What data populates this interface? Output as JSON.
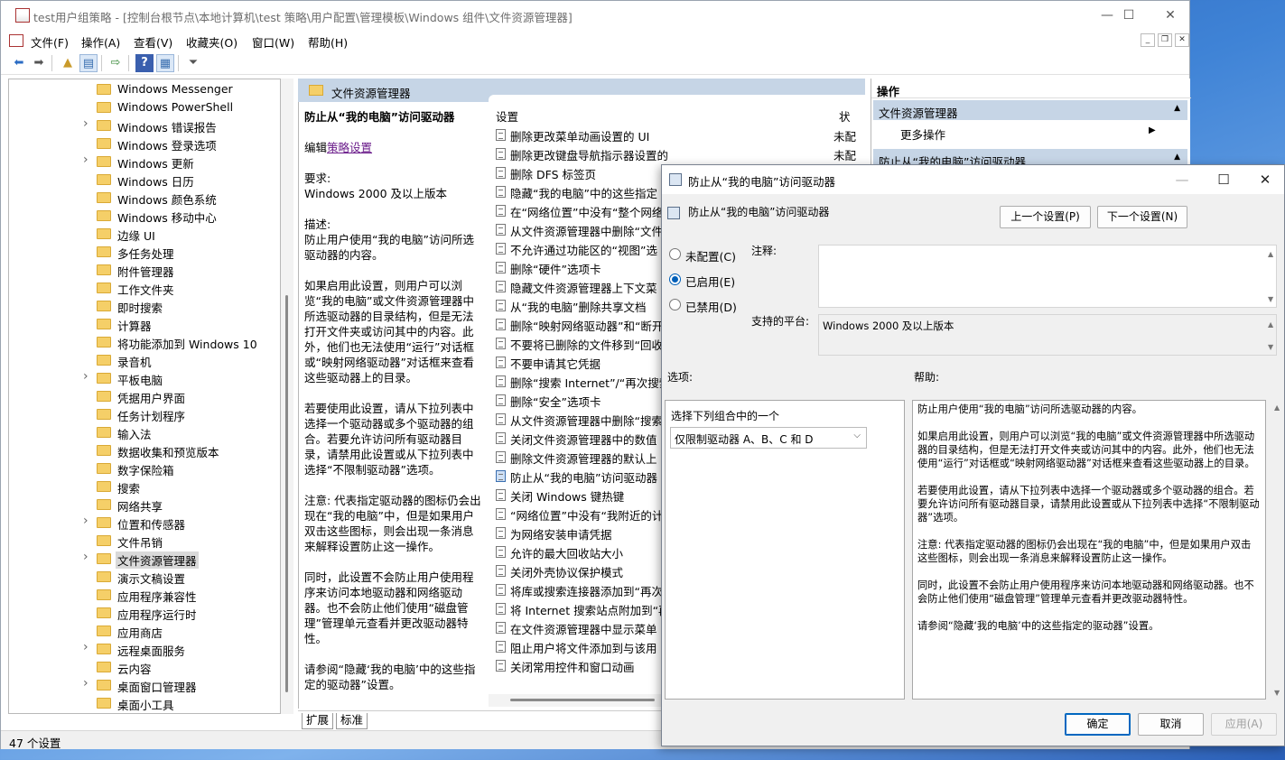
{
  "window": {
    "title": "test用户组策略 - [控制台根节点\\本地计算机\\test 策略\\用户配置\\管理模板\\Windows 组件\\文件资源管理器]",
    "minimize": "—",
    "maximize": "☐",
    "close": "✕"
  },
  "menu": [
    "文件(F)",
    "操作(A)",
    "查看(V)",
    "收藏夹(O)",
    "窗口(W)",
    "帮助(H)"
  ],
  "mdi_controls": [
    "_",
    "❐",
    "✕"
  ],
  "toolbar_icons": [
    "back-arrow-icon",
    "forward-arrow-icon",
    "up-folder-icon",
    "show-tree-icon",
    "export-list-icon",
    "help-icon",
    "show-hide-action-pane-icon",
    "filter-icon"
  ],
  "tree": {
    "items": [
      {
        "label": "Windows Messenger",
        "expandable": false
      },
      {
        "label": "Windows PowerShell",
        "expandable": false
      },
      {
        "label": "Windows 错误报告",
        "expandable": true
      },
      {
        "label": "Windows 登录选项",
        "expandable": false
      },
      {
        "label": "Windows 更新",
        "expandable": true
      },
      {
        "label": "Windows 日历",
        "expandable": false
      },
      {
        "label": "Windows 颜色系统",
        "expandable": false
      },
      {
        "label": "Windows 移动中心",
        "expandable": false
      },
      {
        "label": "边缘 UI",
        "expandable": false
      },
      {
        "label": "多任务处理",
        "expandable": false
      },
      {
        "label": "附件管理器",
        "expandable": false
      },
      {
        "label": "工作文件夹",
        "expandable": false
      },
      {
        "label": "即时搜索",
        "expandable": false
      },
      {
        "label": "计算器",
        "expandable": false
      },
      {
        "label": "将功能添加到 Windows 10",
        "expandable": false
      },
      {
        "label": "录音机",
        "expandable": false
      },
      {
        "label": "平板电脑",
        "expandable": true
      },
      {
        "label": "凭据用户界面",
        "expandable": false
      },
      {
        "label": "任务计划程序",
        "expandable": false
      },
      {
        "label": "输入法",
        "expandable": false
      },
      {
        "label": "数据收集和预览版本",
        "expandable": false
      },
      {
        "label": "数字保险箱",
        "expandable": false
      },
      {
        "label": "搜索",
        "expandable": false
      },
      {
        "label": "网络共享",
        "expandable": false
      },
      {
        "label": "位置和传感器",
        "expandable": true
      },
      {
        "label": "文件吊销",
        "expandable": false
      },
      {
        "label": "文件资源管理器",
        "expandable": true,
        "selected": true
      },
      {
        "label": "演示文稿设置",
        "expandable": false
      },
      {
        "label": "应用程序兼容性",
        "expandable": false
      },
      {
        "label": "应用程序运行时",
        "expandable": false
      },
      {
        "label": "应用商店",
        "expandable": false
      },
      {
        "label": "远程桌面服务",
        "expandable": true
      },
      {
        "label": "云内容",
        "expandable": false
      },
      {
        "label": "桌面窗口管理器",
        "expandable": true
      },
      {
        "label": "桌面小工具",
        "expandable": false
      }
    ]
  },
  "middle": {
    "header": "文件资源管理器",
    "desc": {
      "title": "防止从“我的电脑”访问驱动器",
      "edit_prefix": "编辑",
      "edit_link": "策略设置",
      "req_label": "要求:",
      "req_value": "Windows 2000 及以上版本",
      "desc_label": "描述:",
      "desc_1": "防止用户使用“我的电脑”访问所选驱动器的内容。",
      "desc_2": "如果启用此设置，则用户可以浏览“我的电脑”或文件资源管理器中所选驱动器的目录结构，但是无法打开文件夹或访问其中的内容。此外，他们也无法使用“运行”对话框或“映射网络驱动器”对话框来查看这些驱动器上的目录。",
      "desc_3": "若要使用此设置，请从下拉列表中选择一个驱动器或多个驱动器的组合。若要允许访问所有驱动器目录，请禁用此设置或从下拉列表中选择“不限制驱动器”选项。",
      "desc_4": "注意: 代表指定驱动器的图标仍会出现在“我的电脑”中，但是如果用户双击这些图标，则会出现一条消息来解释设置防止这一操作。",
      "desc_5": " 同时，此设置不会防止用户使用程序来访问本地驱动器和网络驱动器。也不会防止他们使用“磁盘管理”管理单元查看并更改驱动器特性。",
      "desc_6": "请参阅“隐藏‘我的电脑’中的这些指定的驱动器”设置。"
    },
    "col_setting": "设置",
    "col_state": "状",
    "settings": [
      {
        "label": "删除更改菜单动画设置的 UI",
        "state": "未配"
      },
      {
        "label": "删除更改键盘导航指示器设置的 UI",
        "state": "未配"
      },
      {
        "label": "删除 DFS 标签页",
        "state": ""
      },
      {
        "label": "隐藏“我的电脑”中的这些指定",
        "state": ""
      },
      {
        "label": "在“网络位置”中没有“整个网络",
        "state": ""
      },
      {
        "label": "从文件资源管理器中删除“文件",
        "state": ""
      },
      {
        "label": "不允许通过功能区的“视图”选",
        "state": ""
      },
      {
        "label": "删除“硬件”选项卡",
        "state": ""
      },
      {
        "label": "隐藏文件资源管理器上下文菜",
        "state": ""
      },
      {
        "label": "从“我的电脑”删除共享文档",
        "state": ""
      },
      {
        "label": "删除“映射网络驱动器”和“断开",
        "state": ""
      },
      {
        "label": "不要将已删除的文件移到“回收",
        "state": ""
      },
      {
        "label": "不要申请其它凭据",
        "state": ""
      },
      {
        "label": "删除“搜索 Internet”/“再次搜索",
        "state": ""
      },
      {
        "label": "删除“安全”选项卡",
        "state": ""
      },
      {
        "label": "从文件资源管理器中删除“搜索",
        "state": ""
      },
      {
        "label": "关闭文件资源管理器中的数值",
        "state": ""
      },
      {
        "label": "删除文件资源管理器的默认上",
        "state": ""
      },
      {
        "label": "防止从“我的电脑”访问驱动器",
        "state": "",
        "active": true
      },
      {
        "label": "关闭 Windows 键热键",
        "state": ""
      },
      {
        "label": "“网络位置”中没有“我附近的计",
        "state": ""
      },
      {
        "label": "为网络安装申请凭据",
        "state": ""
      },
      {
        "label": "允许的最大回收站大小",
        "state": ""
      },
      {
        "label": "关闭外壳协议保护模式",
        "state": ""
      },
      {
        "label": "将库或搜索连接器添加到“再次",
        "state": ""
      },
      {
        "label": "将 Internet 搜索站点附加到“再",
        "state": ""
      },
      {
        "label": "在文件资源管理器中显示菜单",
        "state": ""
      },
      {
        "label": "阻止用户将文件添加到与该用",
        "state": ""
      },
      {
        "label": "关闭常用控件和窗口动画",
        "state": ""
      }
    ],
    "tabs": [
      "扩展",
      "标准"
    ]
  },
  "status": "47 个设置",
  "actions": {
    "header": "操作",
    "group1": "文件资源管理器",
    "more": "更多操作",
    "group2": "防止从“我的电脑”访问驱动器"
  },
  "dialog": {
    "title": "防止从“我的电脑”访问驱动器",
    "subtitle": "防止从“我的电脑”访问驱动器",
    "prev_btn": "上一个设置(P)",
    "next_btn": "下一个设置(N)",
    "radio_unconfigured": "未配置(C)",
    "radio_enabled": "已启用(E)",
    "radio_disabled": "已禁用(D)",
    "selected_radio": "enabled",
    "comment_label": "注释:",
    "comment_value": "",
    "platform_label": "支持的平台:",
    "platform_value": "Windows 2000 及以上版本",
    "options_label": "选项:",
    "help_label": "帮助:",
    "option_prompt": "选择下列组合中的一个",
    "option_value": "仅限制驱动器 A、B、C 和 D",
    "help": [
      "防止用户使用“我的电脑”访问所选驱动器的内容。",
      "如果启用此设置，则用户可以浏览“我的电脑”或文件资源管理器中所选驱动器的目录结构，但是无法打开文件夹或访问其中的内容。此外，他们也无法使用“运行”对话框或“映射网络驱动器”对话框来查看这些驱动器上的目录。",
      "若要使用此设置，请从下拉列表中选择一个驱动器或多个驱动器的组合。若要允许访问所有驱动器目录，请禁用此设置或从下拉列表中选择“不限制驱动器”选项。",
      "注意: 代表指定驱动器的图标仍会出现在“我的电脑”中，但是如果用户双击这些图标，则会出现一条消息来解释设置防止这一操作。",
      " 同时，此设置不会防止用户使用程序来访问本地驱动器和网络驱动器。也不会防止他们使用“磁盘管理”管理单元查看并更改驱动器特性。",
      "请参阅“隐藏‘我的电脑’中的这些指定的驱动器”设置。"
    ],
    "ok": "确定",
    "cancel": "取消",
    "apply": "应用(A)",
    "win_minimize": "—",
    "win_maximize": "☐",
    "win_close": "✕"
  }
}
